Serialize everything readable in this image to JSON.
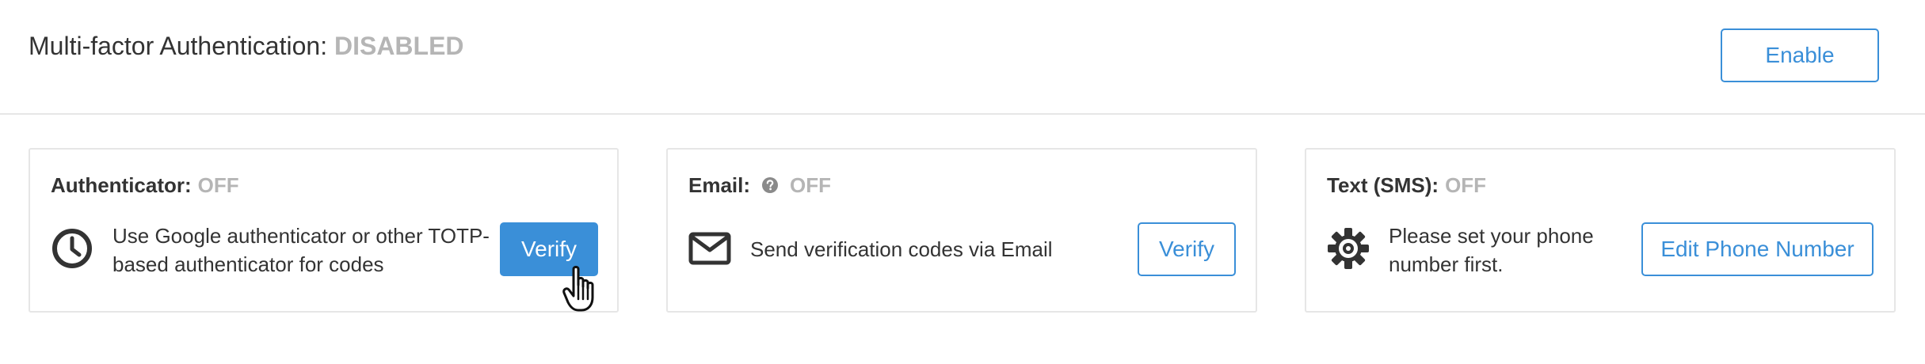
{
  "header": {
    "title": "Multi-factor Authentication:",
    "status": "DISABLED",
    "enable_label": "Enable"
  },
  "cards": [
    {
      "title": "Authenticator:",
      "status": "OFF",
      "icon": "clock-icon",
      "description": "Use Google authenticator or other TOTP-based authenticator for codes",
      "button_label": "Verify"
    },
    {
      "title": "Email:",
      "status": "OFF",
      "icon": "envelope-icon",
      "help_icon": "question-circle-icon",
      "description": "Send verification codes via Email",
      "button_label": "Verify"
    },
    {
      "title": "Text (SMS):",
      "status": "OFF",
      "icon": "gear-icon",
      "description": "Please set your phone number first.",
      "button_label": "Edit Phone Number"
    }
  ],
  "colors": {
    "accent": "#3a8fd8",
    "muted_status": "#b5b5b5",
    "text": "#333333",
    "border": "#e6e6e6"
  },
  "cursor": "hand-pointer-cursor"
}
